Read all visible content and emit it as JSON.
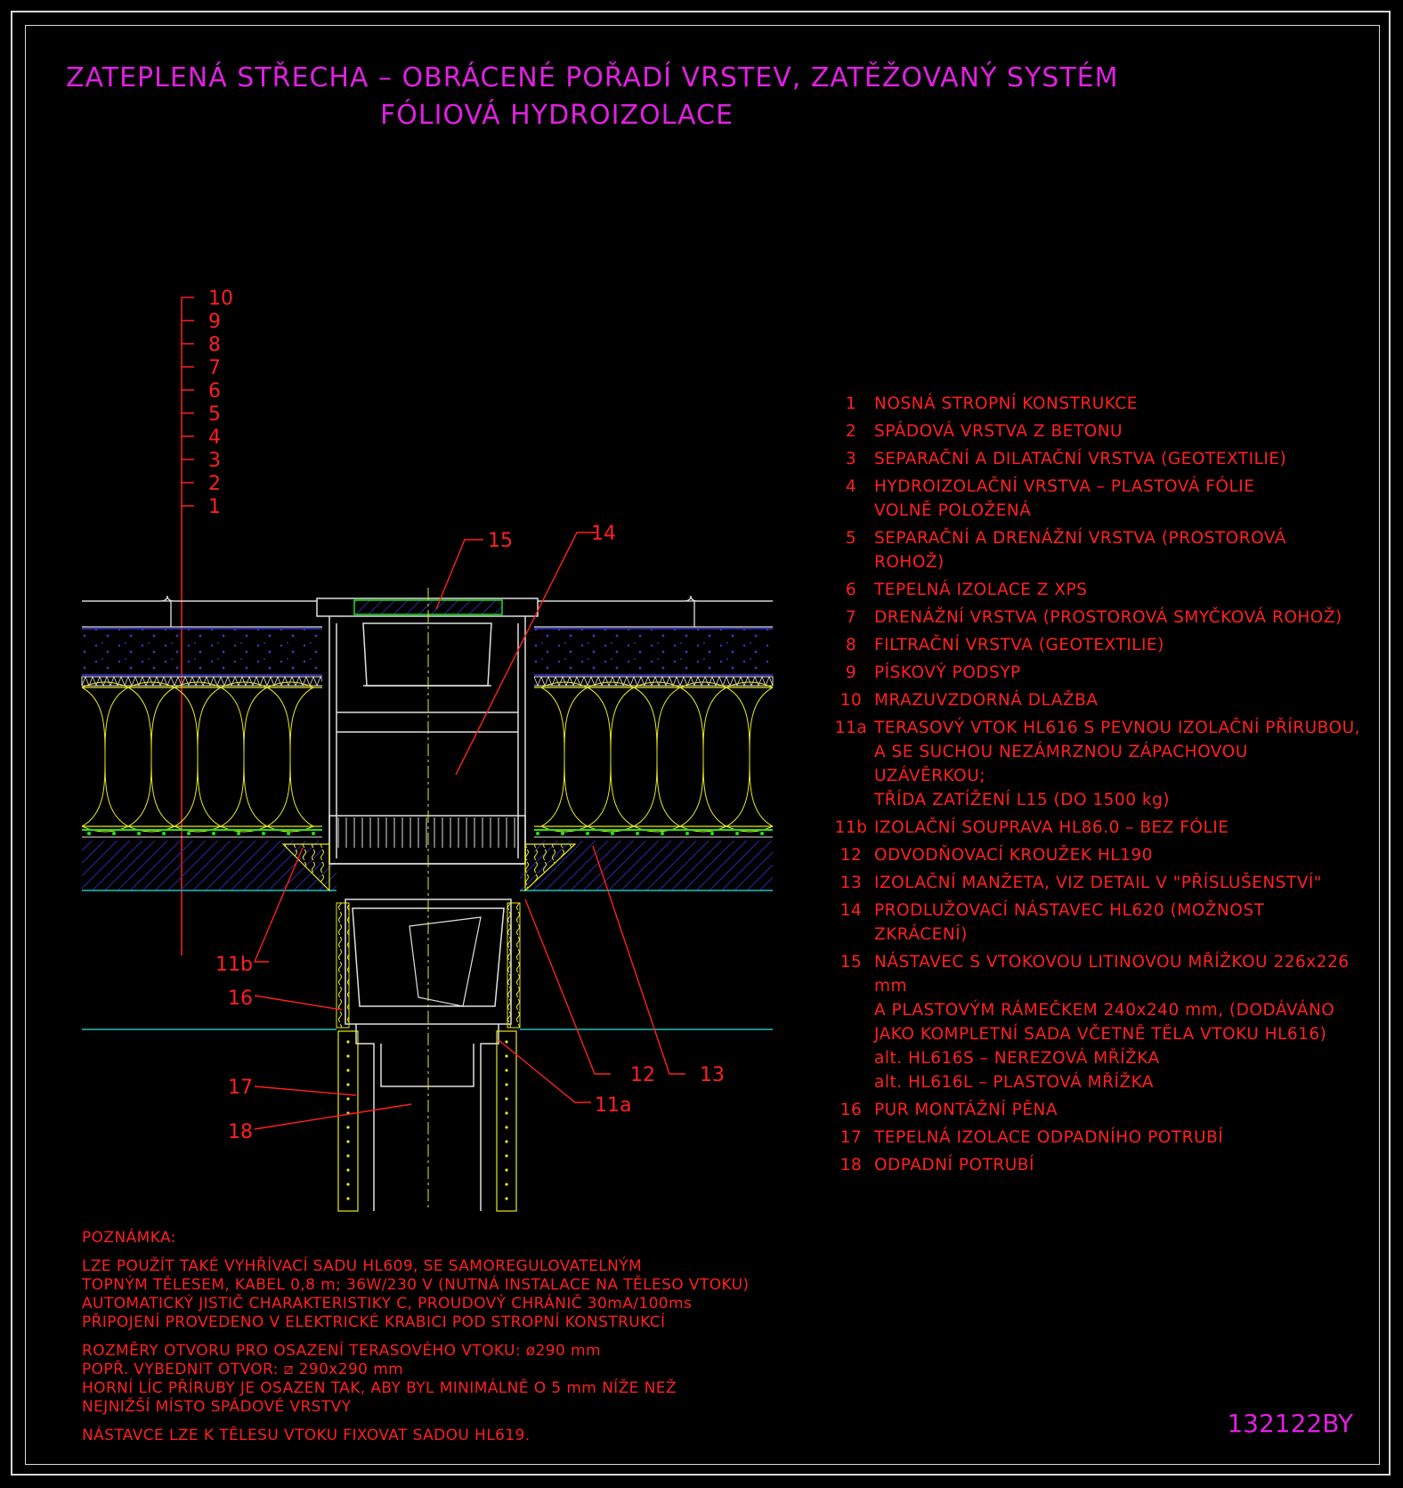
{
  "title": {
    "line1": "ZATEPLENÁ STŘECHA – OBRÁCENÉ POŘADÍ VRSTEV, ZATĚŽOVANÝ SYSTÉM",
    "line2": "FÓLIOVÁ HYDROIZOLACE"
  },
  "layer_scale": [
    "10",
    "9",
    "8",
    "7",
    "6",
    "5",
    "4",
    "3",
    "2",
    "1"
  ],
  "callouts": {
    "c15": "15",
    "c14": "14",
    "c11b": "11b",
    "c16": "16",
    "c17": "17",
    "c18": "18",
    "c12": "12",
    "c13": "13",
    "c11a": "11a"
  },
  "legend": [
    {
      "num": "1",
      "text": "NOSNÁ STROPNÍ KONSTRUKCE"
    },
    {
      "num": "2",
      "text": "SPÁDOVÁ VRSTVA Z BETONU"
    },
    {
      "num": "3",
      "text": "SEPARAČNÍ A DILATAČNÍ VRSTVA (GEOTEXTILIE)"
    },
    {
      "num": "4",
      "text": "HYDROIZOLAČNÍ VRSTVA – PLASTOVÁ FÓLIE\nVOLNĚ POLOŽENÁ"
    },
    {
      "num": "5",
      "text": "SEPARAČNÍ A DRENÁŽNÍ VRSTVA (PROSTOROVÁ ROHOŽ)"
    },
    {
      "num": "6",
      "text": "TEPELNÁ IZOLACE Z XPS"
    },
    {
      "num": "7",
      "text": "DRENÁŽNÍ VRSTVA (PROSTOROVÁ SMYČKOVÁ ROHOŽ)"
    },
    {
      "num": "8",
      "text": "FILTRAČNÍ VRSTVA (GEOTEXTILIE)"
    },
    {
      "num": "9",
      "text": "PÍSKOVÝ PODSYP"
    },
    {
      "num": "10",
      "text": "MRAZUVZDORNÁ DLAŽBA"
    },
    {
      "num": "11a",
      "text": "TERASOVÝ VTOK HL616 S PEVNOU IZOLAČNÍ PŘÍRUBOU,\nA SE SUCHOU NEZÁMRZNOU ZÁPACHOVOU UZÁVĚRKOU;\nTŘÍDA ZATÍŽENÍ L15 (DO 1500 kg)"
    },
    {
      "num": "11b",
      "text": "IZOLAČNÍ SOUPRAVA HL86.0 – BEZ FÓLIE"
    },
    {
      "num": "12",
      "text": "ODVODŇOVACÍ KROUŽEK HL190"
    },
    {
      "num": "13",
      "text": "IZOLAČNÍ MANŽETA, VIZ DETAIL V \"PŘÍSLUŠENSTVÍ\""
    },
    {
      "num": "14",
      "text": "PRODLUŽOVACÍ NÁSTAVEC HL620 (MOŽNOST ZKRÁCENÍ)"
    },
    {
      "num": "15",
      "text": "NÁSTAVEC S VTOKOVOU LITINOVOU MŘÍŽKOU 226x226 mm\nA PLASTOVÝM RÁMEČKEM 240x240 mm, (DODÁVÁNO\nJAKO KOMPLETNÍ SADA VČETNĚ TĚLA VTOKU HL616)\nalt. HL616S – NEREZOVÁ MŘÍŽKA\nalt. HL616L – PLASTOVÁ MŘÍŽKA"
    },
    {
      "num": "16",
      "text": "PUR MONTÁŽNÍ PĚNA"
    },
    {
      "num": "17",
      "text": "TEPELNÁ IZOLACE ODPADNÍHO POTRUBÍ"
    },
    {
      "num": "18",
      "text": "ODPADNÍ POTRUBÍ"
    }
  ],
  "note": {
    "heading": "POZNÁMKA:",
    "block1": "LZE POUŽÍT TAKÉ VYHŘÍVACÍ SADU HL609, SE SAMOREGULOVATELNÝM\nTOPNÝM TĚLESEM, KABEL 0,8 m; 36W/230 V (NUTNÁ INSTALACE NA TĚLESO VTOKU)\nAUTOMATICKÝ JISTIČ CHARAKTERISTIKY C, PROUDOVÝ CHRÁNIČ 30mA/100ms\nPŘIPOJENÍ PROVEDENO V ELEKTRICKÉ KRABICI POD STROPNÍ KONSTRUKCÍ",
    "block2": "ROZMĚRY OTVORU PRO OSAZENÍ TERASOVÉHO VTOKU: ø290 mm\nPOPŘ. VYBEDNIT OTVOR: ⧄ 290x290 mm\nHORNÍ LÍC PŘÍRUBY JE OSAZEN TAK, ABY BYL MINIMÁLNĚ O 5 mm NÍŽE NEŽ\nNEJNIŽŠÍ MÍSTO SPÁDOVÉ VRSTVY",
    "block3": "NÁSTAVCE LZE K TĚLESU VTOKU FIXOVAT SADOU HL619."
  },
  "drawing_code": "132122BY",
  "colors": {
    "background": "#000000",
    "title": "#e020e0",
    "annotation": "#ff2020",
    "insulation": "#e8e820",
    "concrete": "#2020c0",
    "membrane": "#20e020",
    "cyan_line": "#20c0c0",
    "outline": "#e0e0e0",
    "grid": "#20a020"
  }
}
